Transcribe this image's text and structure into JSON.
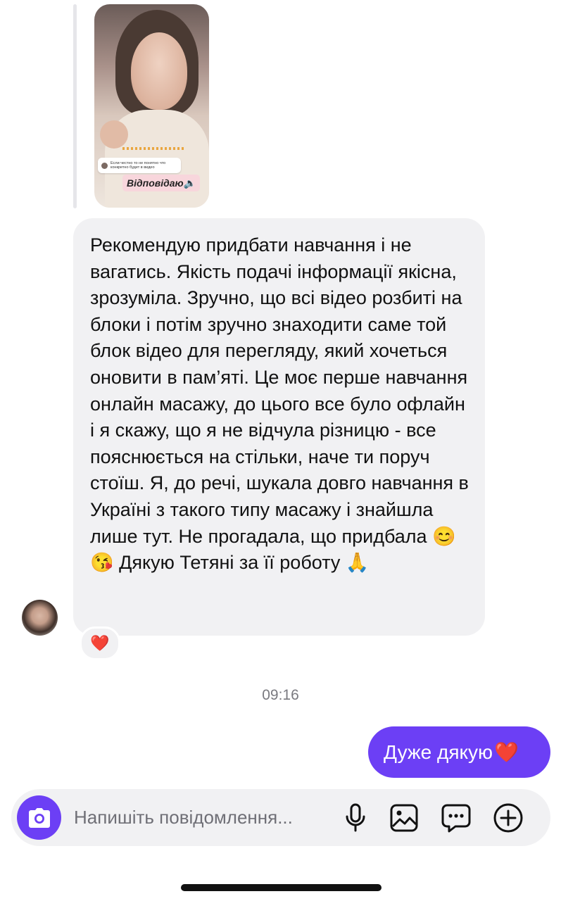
{
  "story_reply": {
    "comment_text": "Если честно то не понятно что конкретно будет в видео",
    "tag_label": "Відповідаю🔈"
  },
  "messages": {
    "incoming": {
      "text": "Рекомендую придбати навчання і не вагатись. Якість подачі інформації якісна, зрозуміла. Зручно, що всі відео розбиті на блоки і потім зручно знаходити саме той блок відео для перегляду, який хочеться оновити в пам’яті. Це моє перше навчання онлайн масажу, до цього все було офлайн і я скажу, що я не відчула різницю - все пояснюється на стільки, наче ти поруч стоїш. Я, до речі, шукала довго навчання в Україні з такого типу масажу і знайшла лише тут. Не прогадала, що придбала 😊 😘 Дякую Тетяні за її роботу 🙏",
      "reaction": "❤️"
    },
    "timestamp": "09:16",
    "outgoing": {
      "text": "Дуже дякую",
      "emoji": "❤️"
    }
  },
  "composer": {
    "placeholder": "Напишіть повідомлення..."
  },
  "colors": {
    "accent": "#6c3ff5",
    "bubble_in": "#f1f1f3",
    "timestamp": "#7a7a80"
  },
  "icons": [
    "camera-icon",
    "microphone-icon",
    "image-icon",
    "sticker-chat-icon",
    "plus-icon"
  ]
}
